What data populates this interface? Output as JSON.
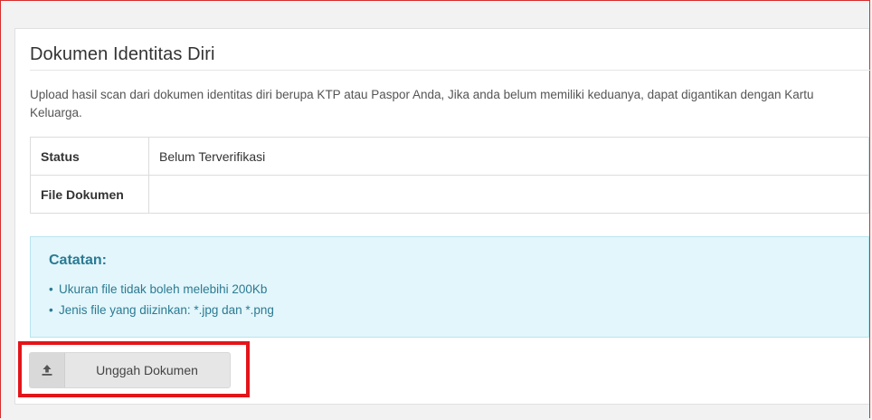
{
  "panel": {
    "title": "Dokumen Identitas Diri",
    "description": "Upload hasil scan dari dokumen identitas diri berupa KTP atau Paspor Anda, Jika anda belum memiliki keduanya, dapat digantikan dengan Kartu Keluarga."
  },
  "table": {
    "rows": [
      {
        "label": "Status",
        "value": "Belum Terverifikasi"
      },
      {
        "label": "File Dokumen",
        "value": ""
      }
    ]
  },
  "note": {
    "title": "Catatan:",
    "items": [
      "Ukuran file tidak boleh melebihi 200Kb",
      "Jenis file yang diizinkan: *.jpg dan *.png"
    ]
  },
  "upload": {
    "label": "Unggah Dokumen",
    "icon": "upload-icon"
  },
  "colors": {
    "highlight": "#e3151a",
    "note_bg": "#e3f6fb",
    "note_text": "#2b7a93"
  }
}
